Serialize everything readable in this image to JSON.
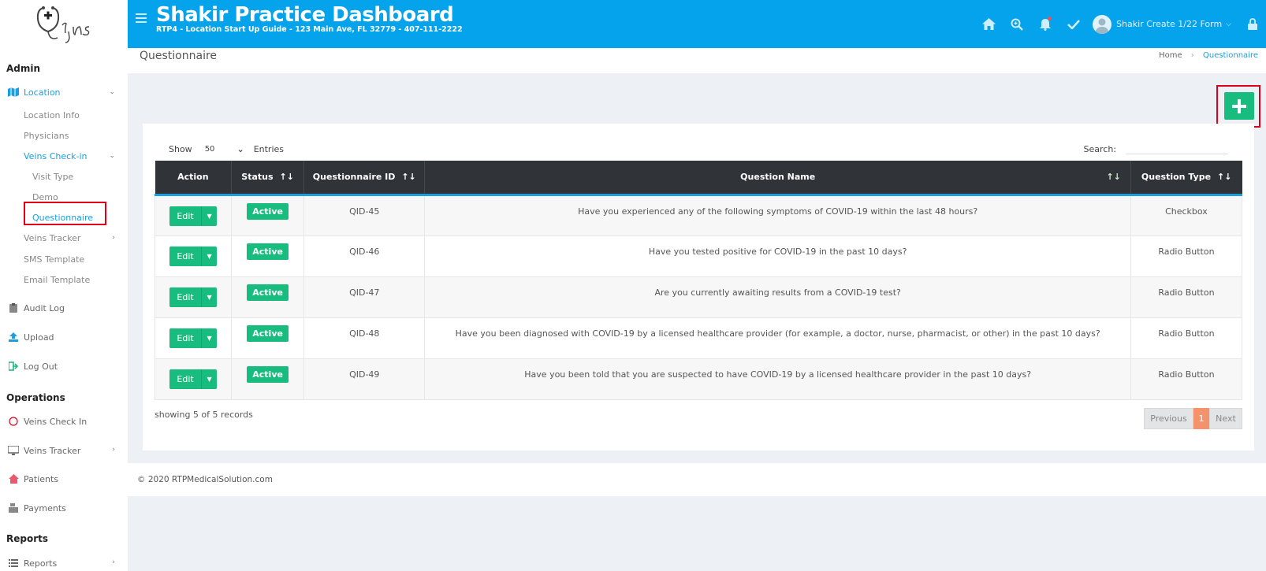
{
  "sidebar": {
    "admin_title": "Admin",
    "operations_title": "Operations",
    "reports_title": "Reports",
    "location": "Location",
    "location_info": "Location Info",
    "physicians": "Physicians",
    "veins_checkin": "Veins Check-in",
    "visit_type": "Visit Type",
    "demo": "Demo",
    "questionnaire": "Questionnaire",
    "veins_tracker": "Veins Tracker",
    "sms_template": "SMS Template",
    "email_template": "Email Template",
    "audit_log": "Audit Log",
    "upload": "Upload",
    "log_out": "Log Out",
    "veins_check_in": "Veins Check In",
    "veins_tracker_ops": "Veins Tracker",
    "patients": "Patients",
    "payments": "Payments",
    "reports": "Reports"
  },
  "header": {
    "title": "Shakir Practice Dashboard",
    "subtitle": "RTP4 - Location Start Up Guide - 123 Main Ave, FL 32779 - 407-111-2222",
    "user_name": "Shakir Create 1/22 Form"
  },
  "breadcrumb": {
    "page_title": "Questionnaire",
    "home": "Home",
    "current": "Questionnaire"
  },
  "table_controls": {
    "show": "Show",
    "entries_value": "50",
    "entries": "Entries",
    "search": "Search:"
  },
  "table": {
    "headers": {
      "action": "Action",
      "status": "Status",
      "qid": "Questionnaire ID",
      "name": "Question Name",
      "type": "Question Type"
    },
    "rows": [
      {
        "edit": "Edit",
        "status": "Active",
        "qid": "QID-45",
        "name": "Have you experienced any of the following symptoms of COVID-19 within the last 48 hours?",
        "type": "Checkbox"
      },
      {
        "edit": "Edit",
        "status": "Active",
        "qid": "QID-46",
        "name": "Have you tested positive for COVID-19 in the past 10 days?",
        "type": "Radio Button"
      },
      {
        "edit": "Edit",
        "status": "Active",
        "qid": "QID-47",
        "name": "Are you currently awaiting results from a COVID-19 test?",
        "type": "Radio Button"
      },
      {
        "edit": "Edit",
        "status": "Active",
        "qid": "QID-48",
        "name": "Have you been diagnosed with COVID-19 by a licensed healthcare provider (for example, a doctor, nurse, pharmacist, or other) in the past 10 days?",
        "type": "Radio Button"
      },
      {
        "edit": "Edit",
        "status": "Active",
        "qid": "QID-49",
        "name": "Have you been told that you are suspected to have COVID-19 by a licensed healthcare provider in the past 10 days?",
        "type": "Radio Button"
      }
    ]
  },
  "pagination": {
    "records": "showing 5 of 5 records",
    "previous": "Previous",
    "page": "1",
    "next": "Next"
  },
  "footer": {
    "copyright": "© 2020 RTPMedicalSolution.com"
  },
  "colors": {
    "header_bg": "#04a3eb",
    "accent_green": "#18bc7e",
    "active_blue": "#1a9fe0",
    "highlight_red": "#e0001a",
    "table_head": "#303338",
    "page_orange": "#f3926b"
  }
}
